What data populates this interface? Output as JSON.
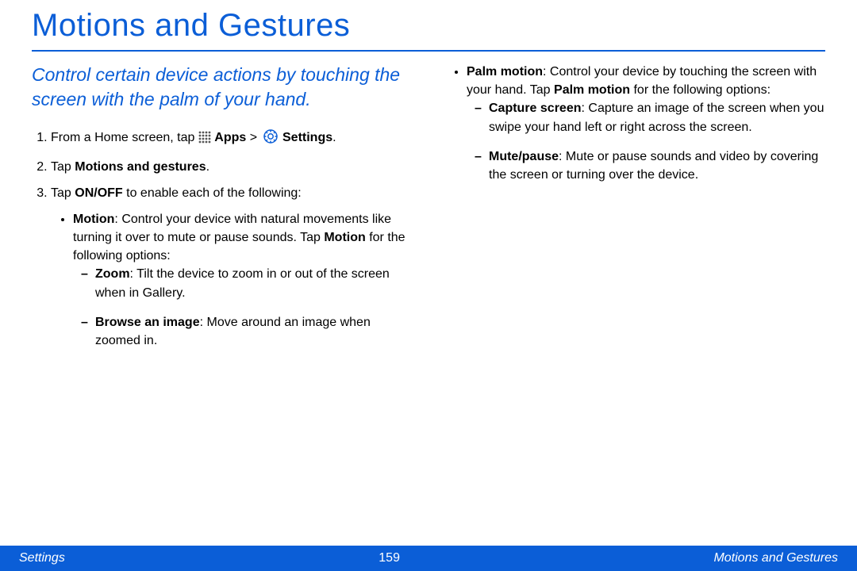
{
  "title": "Motions and Gestures",
  "intro": "Control certain device actions by touching the screen with the palm of your hand.",
  "steps": {
    "s1_a": "From a Home screen, tap ",
    "s1_apps": "Apps",
    "s1_gt": " > ",
    "s1_settings": "Settings",
    "s1_end": ".",
    "s2_a": "Tap ",
    "s2_b": "Motions and gestures",
    "s2_end": ".",
    "s3_a": "Tap ",
    "s3_b": "ON/OFF",
    "s3_c": " to enable each of the following:"
  },
  "motion": {
    "lead_b": "Motion",
    "lead_rest": ": Control your device with natural movements like turning it over to mute or pause sounds. Tap ",
    "tap_b": "Motion",
    "tap_rest": " for the following options:",
    "zoom_b": "Zoom",
    "zoom_rest": ": Tilt the device to zoom in or out of the screen when in Gallery.",
    "browse_b": "Browse an image",
    "browse_rest": ": Move around an image when zoomed in."
  },
  "palm": {
    "lead_b": "Palm motion",
    "lead_rest": ": Control your device by touching the screen with your hand. Tap ",
    "tap_b": "Palm motion",
    "tap_rest": " for the following options:",
    "capture_b": "Capture screen",
    "capture_rest": ": Capture an image of the screen when you swipe your hand left or right across the screen.",
    "mute_b": "Mute/pause",
    "mute_rest": ": Mute or pause sounds and video by covering the screen or turning over the device."
  },
  "footer": {
    "left": "Settings",
    "page": "159",
    "right": "Motions and Gestures"
  }
}
